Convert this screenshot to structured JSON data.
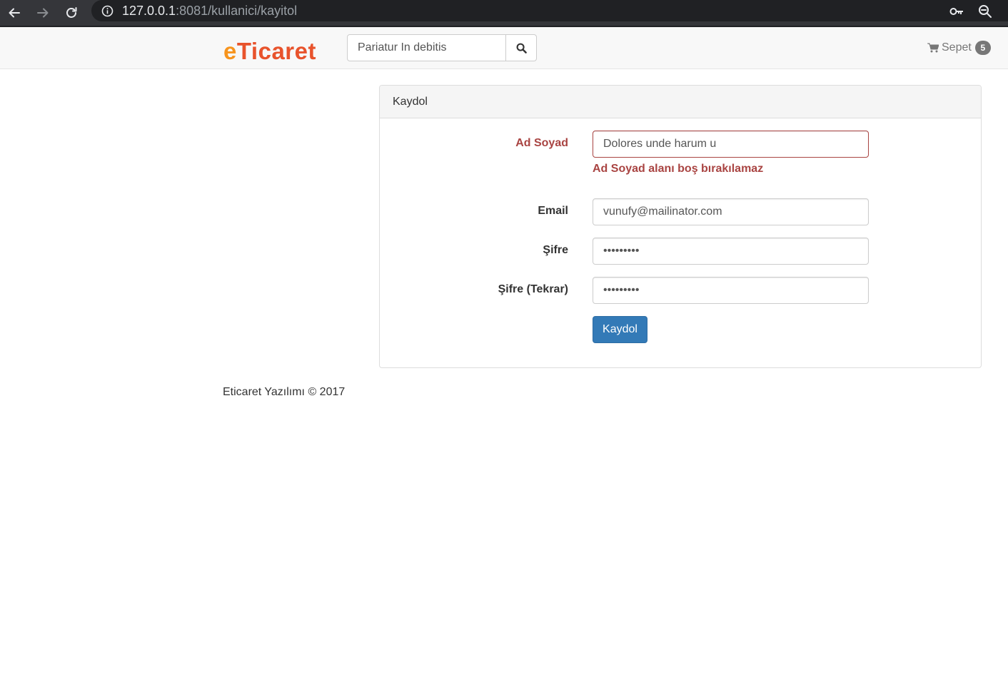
{
  "browser": {
    "url_host": "127.0.0.1",
    "url_rest": ":8081/kullanici/kayitol",
    "icons": [
      "back-icon",
      "forward-icon",
      "reload-icon",
      "info-icon",
      "key-icon",
      "zoom-icon"
    ]
  },
  "navbar": {
    "brand_e": "e",
    "brand_rest": "Ticaret",
    "search_value": "Pariatur In debitis",
    "cart_label": "Sepet",
    "cart_count": "5"
  },
  "panel": {
    "title": "Kaydol",
    "fields": {
      "name_label": "Ad Soyad",
      "name_value": "Dolores unde harum u",
      "name_error": "Ad Soyad alanı boş bırakılamaz",
      "email_label": "Email",
      "email_value": "vunufy@mailinator.com",
      "password_label": "Şifre",
      "password_value": "•••••••••",
      "password_repeat_label": "Şifre (Tekrar)",
      "password_repeat_value": "•••••••••"
    },
    "submit_label": "Kaydol"
  },
  "footer": {
    "text": "Eticaret Yazılımı © 2017"
  },
  "colors": {
    "error": "#a94442",
    "primary": "#337ab7",
    "brand_orange": "#f7941d",
    "brand_red": "#e8532c"
  }
}
